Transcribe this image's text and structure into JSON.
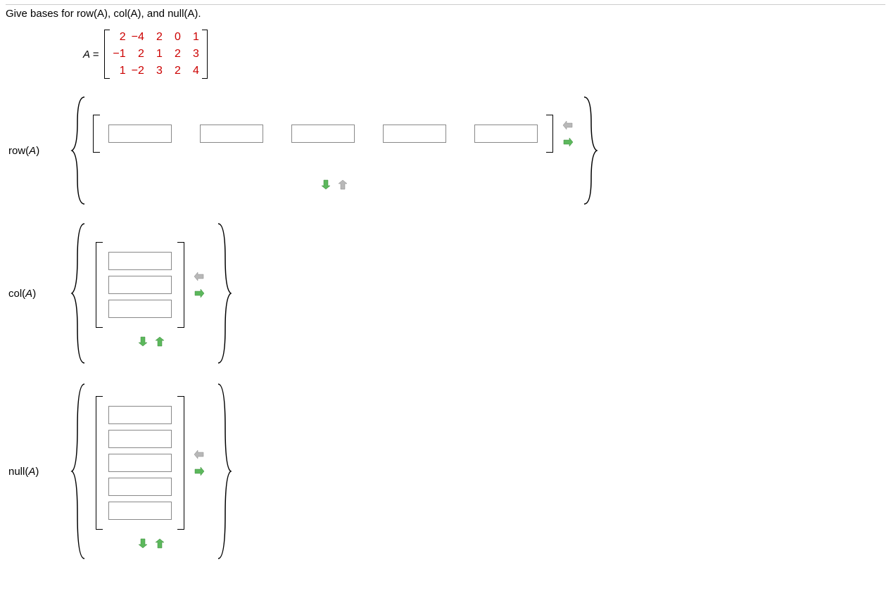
{
  "question": "Give bases for row(A), col(A), and null(A).",
  "matrix_lhs": "A =",
  "matrix": {
    "rows": [
      [
        "2",
        "−4",
        "2",
        "0",
        "1"
      ],
      [
        "−1",
        "2",
        "1",
        "2",
        "3"
      ],
      [
        "1",
        "−2",
        "3",
        "2",
        "4"
      ]
    ]
  },
  "parts": {
    "row": {
      "label": "row(A)",
      "num_inputs": 5
    },
    "col": {
      "label": "col(A)",
      "num_inputs": 3
    },
    "null": {
      "label": "null(A)",
      "num_inputs": 5
    }
  },
  "icons": {
    "remove_col": "arrow-left-icon",
    "add_col": "arrow-right-icon",
    "add_row": "arrow-down-icon",
    "remove_row": "arrow-up-icon"
  }
}
